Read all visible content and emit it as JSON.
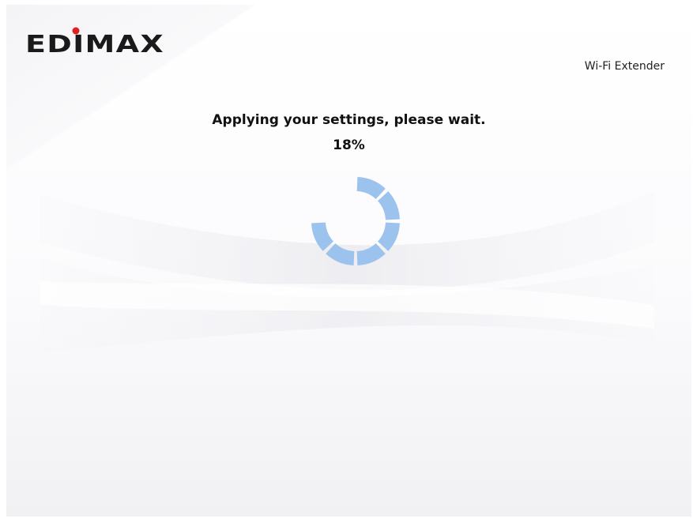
{
  "header": {
    "brand": "EDIMAX",
    "device_name": "Wi-Fi Extender"
  },
  "status": {
    "message": "Applying your settings, please wait.",
    "progress_label": "18%",
    "progress_fraction": 0.18,
    "spinner_segments_total": 8,
    "spinner_segments_lit": 6
  },
  "colors": {
    "spinner": "#9cc3ee",
    "logo_text": "#1a1a1a",
    "logo_dot": "#e02020"
  }
}
